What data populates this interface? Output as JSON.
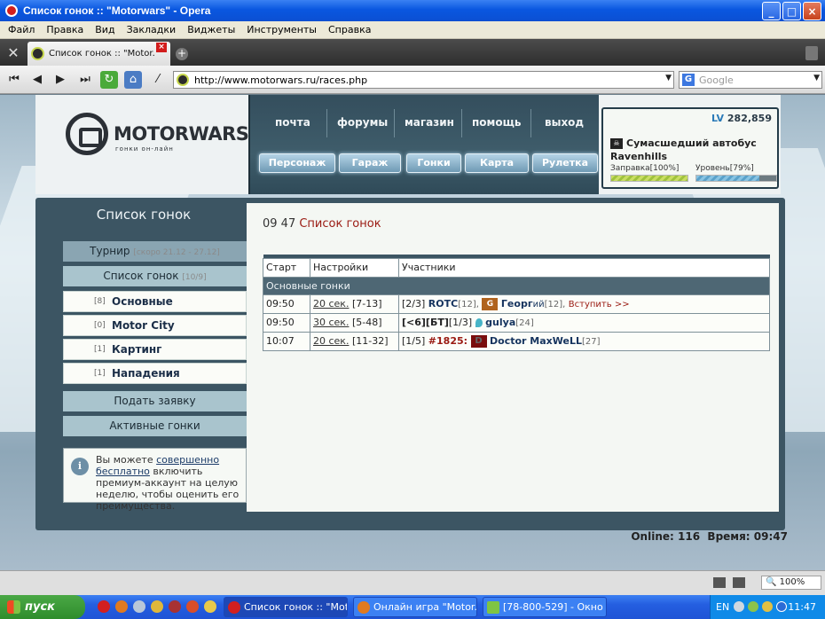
{
  "window": {
    "title": "Список гонок :: \"Motorwars\" - Opera"
  },
  "menu": [
    "Файл",
    "Правка",
    "Вид",
    "Закладки",
    "Виджеты",
    "Инструменты",
    "Справка"
  ],
  "tab": {
    "label": "Список гонок :: \"Motor...",
    "close": "×",
    "new": "+"
  },
  "address": {
    "url": "http://www.motorwars.ru/races.php",
    "search_placeholder": "Google",
    "search_engine": "G"
  },
  "site": {
    "logo_name": "MOTORWARS.RU",
    "logo_sub": "гонки он-лайн",
    "top_nav": [
      "почта",
      "форумы",
      "магазин",
      "помощь",
      "выход"
    ],
    "buttons": [
      "Персонаж",
      "Гараж",
      "Гонки",
      "Карта",
      "Рулетка"
    ]
  },
  "stats": {
    "lv_label": "LV",
    "lv_value": "282,859",
    "car": "Сумасшедший автобус",
    "owner": "Ravenhills",
    "fuel_label": "Заправка[100%]",
    "fuel_pct": 100,
    "level_label": "Уровень[79%]",
    "level_pct": 79
  },
  "sidebar": {
    "title": "Список гонок",
    "tournament": "Турнир",
    "tournament_note": "[скоро 21.12 - 27.12]",
    "races_list": "Список гонок",
    "races_count": "[10/9]",
    "items": [
      {
        "n": "[8]",
        "label": "Основные"
      },
      {
        "n": "[0]",
        "label": "Motor City"
      },
      {
        "n": "[1]",
        "label": "Картинг"
      },
      {
        "n": "[1]",
        "label": "Нападения"
      }
    ],
    "apply": "Подать заявку",
    "active": "Активные гонки",
    "info": {
      "pre": "Вы можете ",
      "link1": "совершенно",
      "link2": "бесплатно",
      "post": " включить премиум-аккаунт на целую неделю, чтобы оценить его преимущества."
    }
  },
  "main": {
    "time": "09 47",
    "title": "Список гонок",
    "headers": [
      "Старт",
      "Настройки",
      "Участники"
    ],
    "group": "Основные гонки",
    "rows": [
      {
        "start": "09:50",
        "setting": "20 сек.",
        "range": "[7-13]",
        "count": "[2/3]",
        "p1": "ROTC",
        "p1lvl": "[12],",
        "p2av": "G",
        "p2": "Георг",
        "p2b": "ий",
        "p2lvl": "[12],",
        "join": "Вступить >>"
      },
      {
        "start": "09:50",
        "setting": "30 сек.",
        "range": "[5-48]",
        "clan": "[<6][БТ]",
        "count": "[1/3]",
        "p1": "gulya",
        "p1lvl": "[24]"
      },
      {
        "start": "10:07",
        "setting": "20 сек.",
        "range": "[11-32]",
        "count": "[1/5]",
        "race": "#1825:",
        "p1av": "D",
        "p1": "Doctor MaxWeLL",
        "p1lvl": "[27]"
      }
    ]
  },
  "footer": {
    "online_label": "Online:",
    "online": "116",
    "time_label": "Время:",
    "time": "09:47"
  },
  "status": {
    "zoom": "100%"
  },
  "taskbar": {
    "start": "пуск",
    "tasks": [
      "Список гонок :: \"Mot...",
      "Онлайн игра \"Motor...",
      "[78-800-529] - Окно ..."
    ],
    "lang": "EN",
    "clock": "11:47"
  },
  "colors": {
    "accent_red": "#9a1a12",
    "panel": "#3c5563",
    "xp_blue": "#245ee0"
  }
}
